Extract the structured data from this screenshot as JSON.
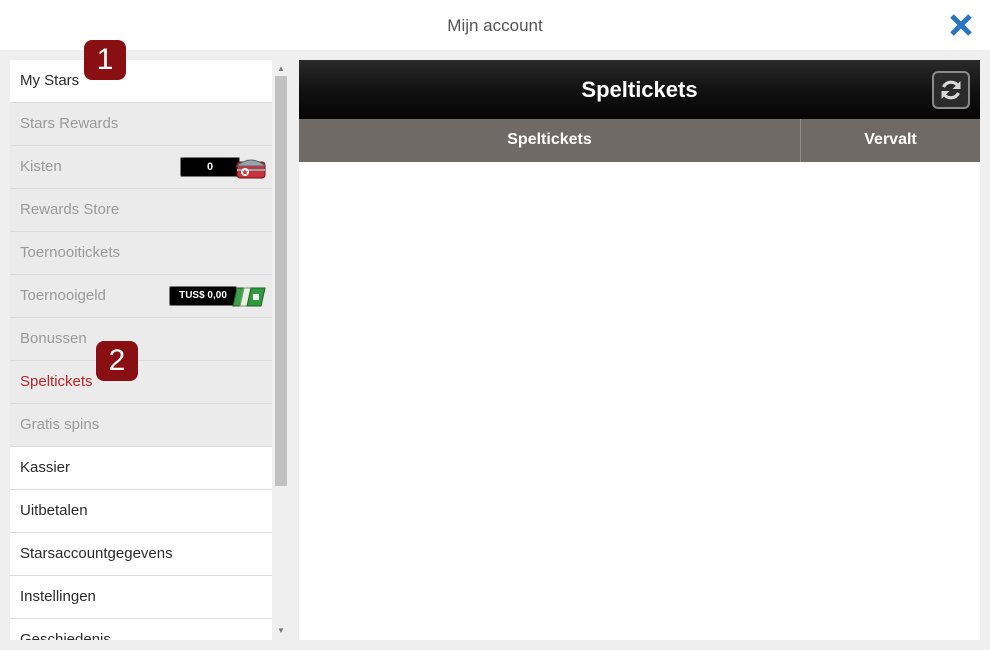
{
  "window": {
    "title": "Mijn account"
  },
  "sidebar": {
    "items": [
      {
        "label": "My Stars"
      },
      {
        "label": "Stars Rewards"
      },
      {
        "label": "Kisten"
      },
      {
        "label": "Rewards Store"
      },
      {
        "label": "Toernooitickets"
      },
      {
        "label": "Toernooigeld"
      },
      {
        "label": "Bonussen"
      },
      {
        "label": "Speltickets"
      },
      {
        "label": "Gratis spins"
      },
      {
        "label": "Kassier"
      },
      {
        "label": "Uitbetalen"
      },
      {
        "label": "Starsaccountgegevens"
      },
      {
        "label": "Instellingen"
      },
      {
        "label": "Geschiedenis"
      }
    ],
    "kisten_count": "0",
    "toernooigeld_balance": "TUS$ 0,00"
  },
  "markers": {
    "first": "1",
    "second": "2"
  },
  "main": {
    "title": "Speltickets",
    "columns": [
      "Speltickets",
      "Vervalt"
    ]
  },
  "colors": {
    "active": "#b8252b",
    "close": "#2a74c4",
    "marker": "#8a0f12"
  }
}
